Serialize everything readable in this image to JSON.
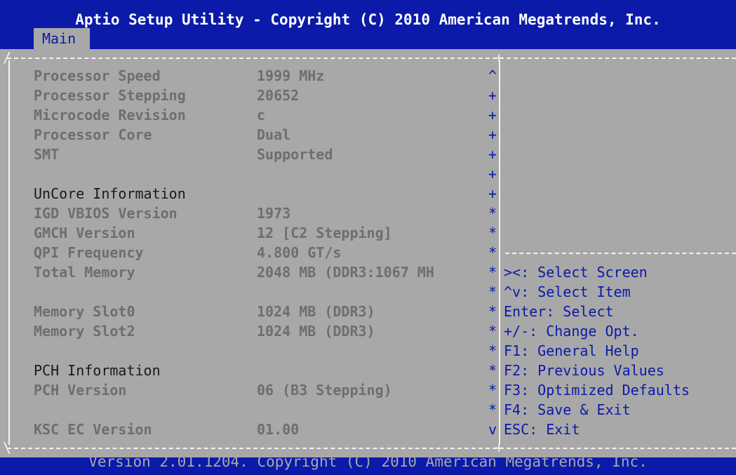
{
  "header": {
    "title": "Aptio Setup Utility - Copyright (C) 2010 American Megatrends, Inc.",
    "tabs": [
      {
        "label": "Main"
      }
    ]
  },
  "info_rows": [
    {
      "label": "Processor Speed",
      "value": "1999 MHz"
    },
    {
      "label": "Processor Stepping",
      "value": "20652"
    },
    {
      "label": "Microcode Revision",
      "value": "c"
    },
    {
      "label": "Processor Core",
      "value": "Dual"
    },
    {
      "label": "SMT",
      "value": "Supported"
    },
    {
      "heading": "UnCore Information"
    },
    {
      "label": "IGD VBIOS Version",
      "value": "1973"
    },
    {
      "label": "GMCH Version",
      "value": "12 [C2 Stepping]"
    },
    {
      "label": "QPI Frequency",
      "value": "4.800 GT/s"
    },
    {
      "label": "Total Memory",
      "value": "2048 MB (DDR3:1067 MH"
    },
    {
      "label": "Memory Slot0",
      "value": "1024 MB (DDR3)"
    },
    {
      "label": "Memory Slot2",
      "value": "1024 MB (DDR3)"
    },
    {
      "heading": "PCH Information"
    },
    {
      "label": "PCH Version",
      "value": "06 (B3 Stepping)"
    },
    {
      "label": "KSC EC Version",
      "value": "01.00"
    }
  ],
  "scroll_indicators": [
    "^",
    "+",
    "+",
    "+",
    "+",
    "+",
    "+",
    "*",
    "*",
    "*",
    "*",
    "*",
    "*",
    "*",
    "*",
    "*",
    "*",
    "*",
    "*",
    "v"
  ],
  "help": [
    "><: Select Screen",
    "^v: Select Item",
    "Enter: Select",
    "+/-: Change Opt.",
    "F1: General Help",
    "F2: Previous Values",
    "F3: Optimized Defaults",
    "F4: Save & Exit",
    "ESC: Exit"
  ],
  "footer": {
    "text": "Version 2.01.1204. Copyright (C) 2010 American Megatrends, Inc."
  },
  "colors": {
    "background": "#a8a8a8",
    "bar": "#0b1aa8",
    "title_text": "#ffffff",
    "help_text": "#0b1aa8",
    "label_text": "#6e6e6e"
  }
}
